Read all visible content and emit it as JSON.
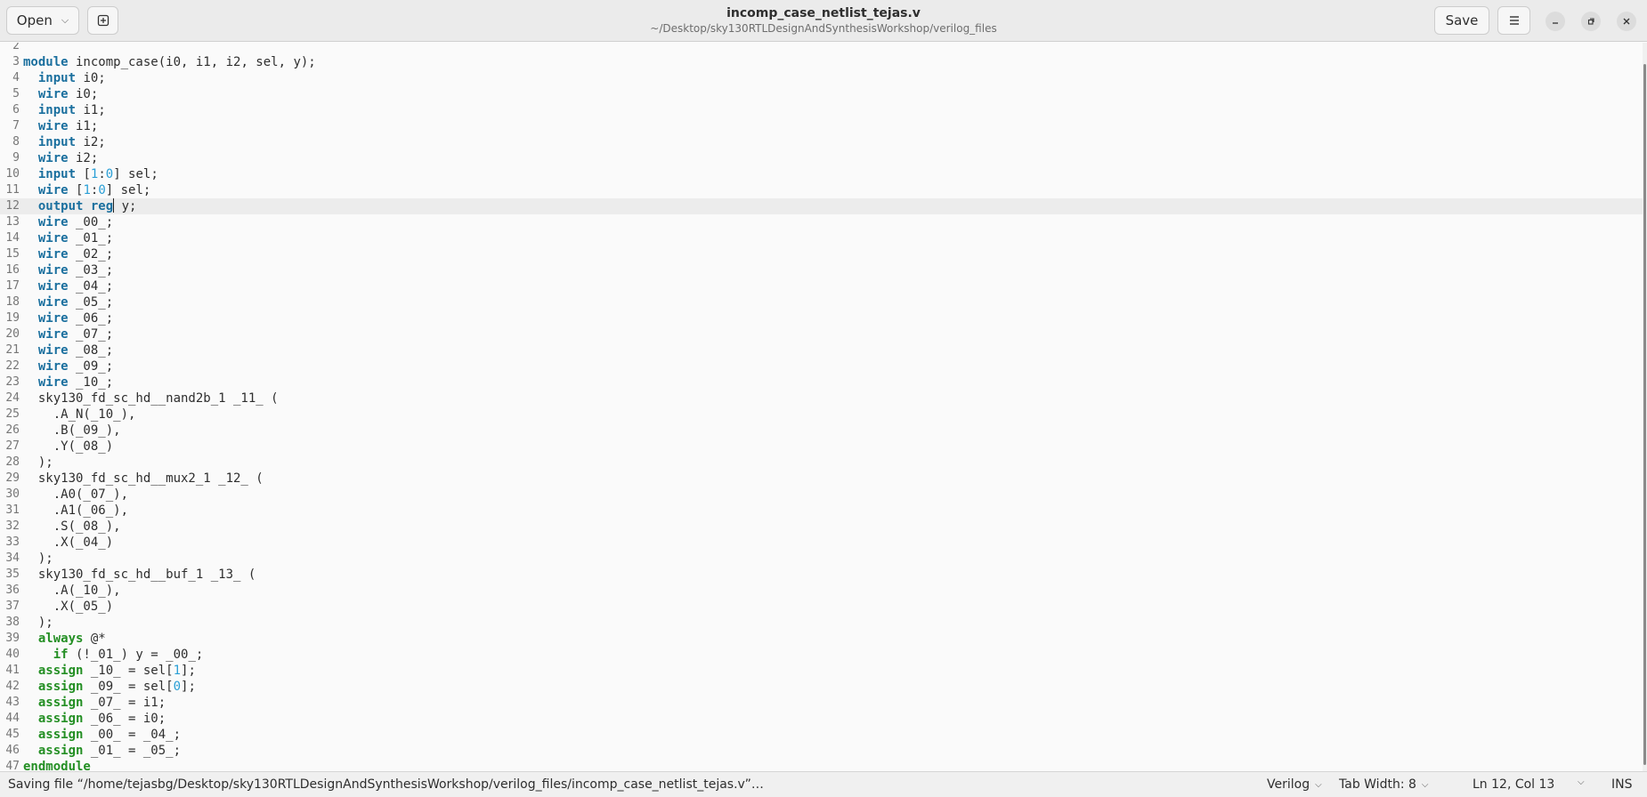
{
  "header": {
    "open_label": "Open",
    "save_label": "Save",
    "title": "incomp_case_netlist_tejas.v",
    "subtitle": "~/Desktop/sky130RTLDesignAndSynthesisWorkshop/verilog_files",
    "icons": {
      "open_dropdown": "chevron-down-icon",
      "new_tab": "new-tab-icon",
      "menu": "hamburger-menu-icon",
      "minimize": "minimize-icon",
      "maximize": "maximize-icon",
      "close": "close-icon"
    }
  },
  "editor": {
    "current_line": 12,
    "lines": [
      {
        "n": "2",
        "tokens": []
      },
      {
        "n": "3",
        "tokens": [
          [
            "kb",
            "module"
          ],
          [
            "t",
            " incomp_case(i0, i1, i2, sel, y);"
          ]
        ]
      },
      {
        "n": "4",
        "tokens": [
          [
            "t",
            "  "
          ],
          [
            "kb",
            "input"
          ],
          [
            "t",
            " i0;"
          ]
        ]
      },
      {
        "n": "5",
        "tokens": [
          [
            "t",
            "  "
          ],
          [
            "kb",
            "wire"
          ],
          [
            "t",
            " i0;"
          ]
        ]
      },
      {
        "n": "6",
        "tokens": [
          [
            "t",
            "  "
          ],
          [
            "kb",
            "input"
          ],
          [
            "t",
            " i1;"
          ]
        ]
      },
      {
        "n": "7",
        "tokens": [
          [
            "t",
            "  "
          ],
          [
            "kb",
            "wire"
          ],
          [
            "t",
            " i1;"
          ]
        ]
      },
      {
        "n": "8",
        "tokens": [
          [
            "t",
            "  "
          ],
          [
            "kb",
            "input"
          ],
          [
            "t",
            " i2;"
          ]
        ]
      },
      {
        "n": "9",
        "tokens": [
          [
            "t",
            "  "
          ],
          [
            "kb",
            "wire"
          ],
          [
            "t",
            " i2;"
          ]
        ]
      },
      {
        "n": "10",
        "tokens": [
          [
            "t",
            "  "
          ],
          [
            "kb",
            "input"
          ],
          [
            "t",
            " ["
          ],
          [
            "num",
            "1"
          ],
          [
            "t",
            ":"
          ],
          [
            "num",
            "0"
          ],
          [
            "t",
            "] sel;"
          ]
        ]
      },
      {
        "n": "11",
        "tokens": [
          [
            "t",
            "  "
          ],
          [
            "kb",
            "wire"
          ],
          [
            "t",
            " ["
          ],
          [
            "num",
            "1"
          ],
          [
            "t",
            ":"
          ],
          [
            "num",
            "0"
          ],
          [
            "t",
            "] sel;"
          ]
        ]
      },
      {
        "n": "12",
        "tokens": [
          [
            "t",
            "  "
          ],
          [
            "kb",
            "output"
          ],
          [
            "t",
            " "
          ],
          [
            "kb",
            "reg"
          ],
          [
            "caret",
            ""
          ],
          [
            "t",
            " y;"
          ]
        ]
      },
      {
        "n": "13",
        "tokens": [
          [
            "t",
            "  "
          ],
          [
            "kb",
            "wire"
          ],
          [
            "t",
            " _00_;"
          ]
        ]
      },
      {
        "n": "14",
        "tokens": [
          [
            "t",
            "  "
          ],
          [
            "kb",
            "wire"
          ],
          [
            "t",
            " _01_;"
          ]
        ]
      },
      {
        "n": "15",
        "tokens": [
          [
            "t",
            "  "
          ],
          [
            "kb",
            "wire"
          ],
          [
            "t",
            " _02_;"
          ]
        ]
      },
      {
        "n": "16",
        "tokens": [
          [
            "t",
            "  "
          ],
          [
            "kb",
            "wire"
          ],
          [
            "t",
            " _03_;"
          ]
        ]
      },
      {
        "n": "17",
        "tokens": [
          [
            "t",
            "  "
          ],
          [
            "kb",
            "wire"
          ],
          [
            "t",
            " _04_;"
          ]
        ]
      },
      {
        "n": "18",
        "tokens": [
          [
            "t",
            "  "
          ],
          [
            "kb",
            "wire"
          ],
          [
            "t",
            " _05_;"
          ]
        ]
      },
      {
        "n": "19",
        "tokens": [
          [
            "t",
            "  "
          ],
          [
            "kb",
            "wire"
          ],
          [
            "t",
            " _06_;"
          ]
        ]
      },
      {
        "n": "20",
        "tokens": [
          [
            "t",
            "  "
          ],
          [
            "kb",
            "wire"
          ],
          [
            "t",
            " _07_;"
          ]
        ]
      },
      {
        "n": "21",
        "tokens": [
          [
            "t",
            "  "
          ],
          [
            "kb",
            "wire"
          ],
          [
            "t",
            " _08_;"
          ]
        ]
      },
      {
        "n": "22",
        "tokens": [
          [
            "t",
            "  "
          ],
          [
            "kb",
            "wire"
          ],
          [
            "t",
            " _09_;"
          ]
        ]
      },
      {
        "n": "23",
        "tokens": [
          [
            "t",
            "  "
          ],
          [
            "kb",
            "wire"
          ],
          [
            "t",
            " _10_;"
          ]
        ]
      },
      {
        "n": "24",
        "tokens": [
          [
            "t",
            "  sky130_fd_sc_hd__nand2b_1 _11_ ("
          ]
        ]
      },
      {
        "n": "25",
        "tokens": [
          [
            "t",
            "    .A_N(_10_),"
          ]
        ]
      },
      {
        "n": "26",
        "tokens": [
          [
            "t",
            "    .B(_09_),"
          ]
        ]
      },
      {
        "n": "27",
        "tokens": [
          [
            "t",
            "    .Y(_08_)"
          ]
        ]
      },
      {
        "n": "28",
        "tokens": [
          [
            "t",
            "  );"
          ]
        ]
      },
      {
        "n": "29",
        "tokens": [
          [
            "t",
            "  sky130_fd_sc_hd__mux2_1 _12_ ("
          ]
        ]
      },
      {
        "n": "30",
        "tokens": [
          [
            "t",
            "    .A0(_07_),"
          ]
        ]
      },
      {
        "n": "31",
        "tokens": [
          [
            "t",
            "    .A1(_06_),"
          ]
        ]
      },
      {
        "n": "32",
        "tokens": [
          [
            "t",
            "    .S(_08_),"
          ]
        ]
      },
      {
        "n": "33",
        "tokens": [
          [
            "t",
            "    .X(_04_)"
          ]
        ]
      },
      {
        "n": "34",
        "tokens": [
          [
            "t",
            "  );"
          ]
        ]
      },
      {
        "n": "35",
        "tokens": [
          [
            "t",
            "  sky130_fd_sc_hd__buf_1 _13_ ("
          ]
        ]
      },
      {
        "n": "36",
        "tokens": [
          [
            "t",
            "    .A(_10_),"
          ]
        ]
      },
      {
        "n": "37",
        "tokens": [
          [
            "t",
            "    .X(_05_)"
          ]
        ]
      },
      {
        "n": "38",
        "tokens": [
          [
            "t",
            "  );"
          ]
        ]
      },
      {
        "n": "39",
        "tokens": [
          [
            "t",
            "  "
          ],
          [
            "kg",
            "always"
          ],
          [
            "t",
            " @*"
          ]
        ]
      },
      {
        "n": "40",
        "tokens": [
          [
            "t",
            "    "
          ],
          [
            "kg",
            "if"
          ],
          [
            "t",
            " (!_01_) y = _00_;"
          ]
        ]
      },
      {
        "n": "41",
        "tokens": [
          [
            "t",
            "  "
          ],
          [
            "kg",
            "assign"
          ],
          [
            "t",
            " _10_ = sel["
          ],
          [
            "num",
            "1"
          ],
          [
            "t",
            "];"
          ]
        ]
      },
      {
        "n": "42",
        "tokens": [
          [
            "t",
            "  "
          ],
          [
            "kg",
            "assign"
          ],
          [
            "t",
            " _09_ = sel["
          ],
          [
            "num",
            "0"
          ],
          [
            "t",
            "];"
          ]
        ]
      },
      {
        "n": "43",
        "tokens": [
          [
            "t",
            "  "
          ],
          [
            "kg",
            "assign"
          ],
          [
            "t",
            " _07_ = i1;"
          ]
        ]
      },
      {
        "n": "44",
        "tokens": [
          [
            "t",
            "  "
          ],
          [
            "kg",
            "assign"
          ],
          [
            "t",
            " _06_ = i0;"
          ]
        ]
      },
      {
        "n": "45",
        "tokens": [
          [
            "t",
            "  "
          ],
          [
            "kg",
            "assign"
          ],
          [
            "t",
            " _00_ = _04_;"
          ]
        ]
      },
      {
        "n": "46",
        "tokens": [
          [
            "t",
            "  "
          ],
          [
            "kg",
            "assign"
          ],
          [
            "t",
            " _01_ = _05_;"
          ]
        ]
      },
      {
        "n": "47",
        "tokens": [
          [
            "kg",
            "endmodule"
          ]
        ]
      }
    ]
  },
  "statusbar": {
    "message": "Saving file “/home/tejasbg/Desktop/sky130RTLDesignAndSynthesisWorkshop/verilog_files/incomp_case_netlist_tejas.v”…",
    "language": "Verilog",
    "tab_width": "Tab Width: 8",
    "position": "Ln 12, Col 13",
    "insert_mode": "INS"
  },
  "colors": {
    "keyword_blue": "#1a6f9e",
    "keyword_green": "#248f24",
    "number": "#2a9fd6",
    "current_line_bg": "#ececec"
  }
}
